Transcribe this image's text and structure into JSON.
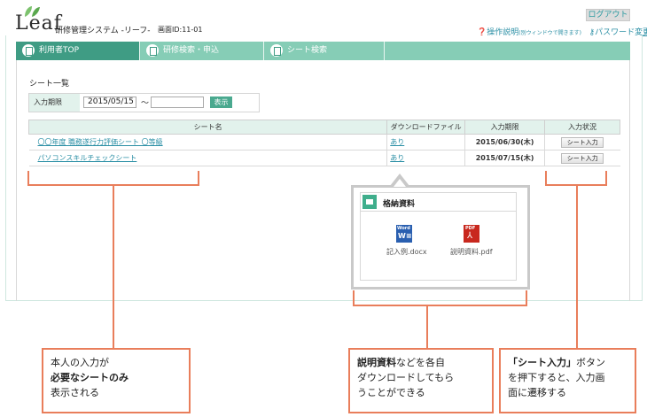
{
  "header": {
    "logo_text": "Leaf",
    "system_title": "研修管理システム -リーフ-",
    "screen_id": "画面ID:11-01",
    "logout_label": "ログアウト",
    "help_label": "操作説明",
    "help_note": "(別ウィンドウで開きます)",
    "password_label": "パスワード変更"
  },
  "tabs": [
    {
      "label": "利用者TOP",
      "active": true
    },
    {
      "label": "研修検索・申込",
      "active": false
    },
    {
      "label": "シート検索",
      "active": false
    }
  ],
  "main": {
    "section_title": "シート一覧",
    "filter": {
      "label": "入力期限",
      "from_value": "2015/05/15",
      "to_value": "",
      "tilde": "～",
      "button_label": "表示"
    },
    "table": {
      "headers": [
        "シート名",
        "ダウンロードファイル",
        "入力期限",
        "入力状況"
      ],
      "rows": [
        {
          "name": "〇〇年度 職務遂行力評価シート 〇等級",
          "download": "あり",
          "deadline": "2015/06/30(木)",
          "action": "シート入力"
        },
        {
          "name": "パソコンスキルチェックシート",
          "download": "あり",
          "deadline": "2015/07/15(木)",
          "action": "シート入力"
        }
      ]
    }
  },
  "popup": {
    "title": "格納資料",
    "files": [
      {
        "name": "記入例.docx",
        "icon": "word-file-icon"
      },
      {
        "name": "説明資料.pdf",
        "icon": "pdf-file-icon"
      }
    ]
  },
  "callouts": {
    "c1_line1": "本人の入力が",
    "c1_line2": "必要なシートのみ",
    "c1_line3": "表示される",
    "c2_bold": "説明資料",
    "c2_rest1": "などを各自",
    "c2_line2": "ダウンロードしてもら",
    "c2_line3": "うことができる",
    "c3_bold": "「シート入力」",
    "c3_rest1": "ボタン",
    "c3_line2": "を押下すると、入力画",
    "c3_line3": "面に遷移する"
  },
  "colors": {
    "accent": "#3f9c84",
    "tab_bar": "#86cdb6",
    "header_cell": "#e2f2ec",
    "link": "#2b8fa5",
    "callout_border": "#e97e5b"
  }
}
